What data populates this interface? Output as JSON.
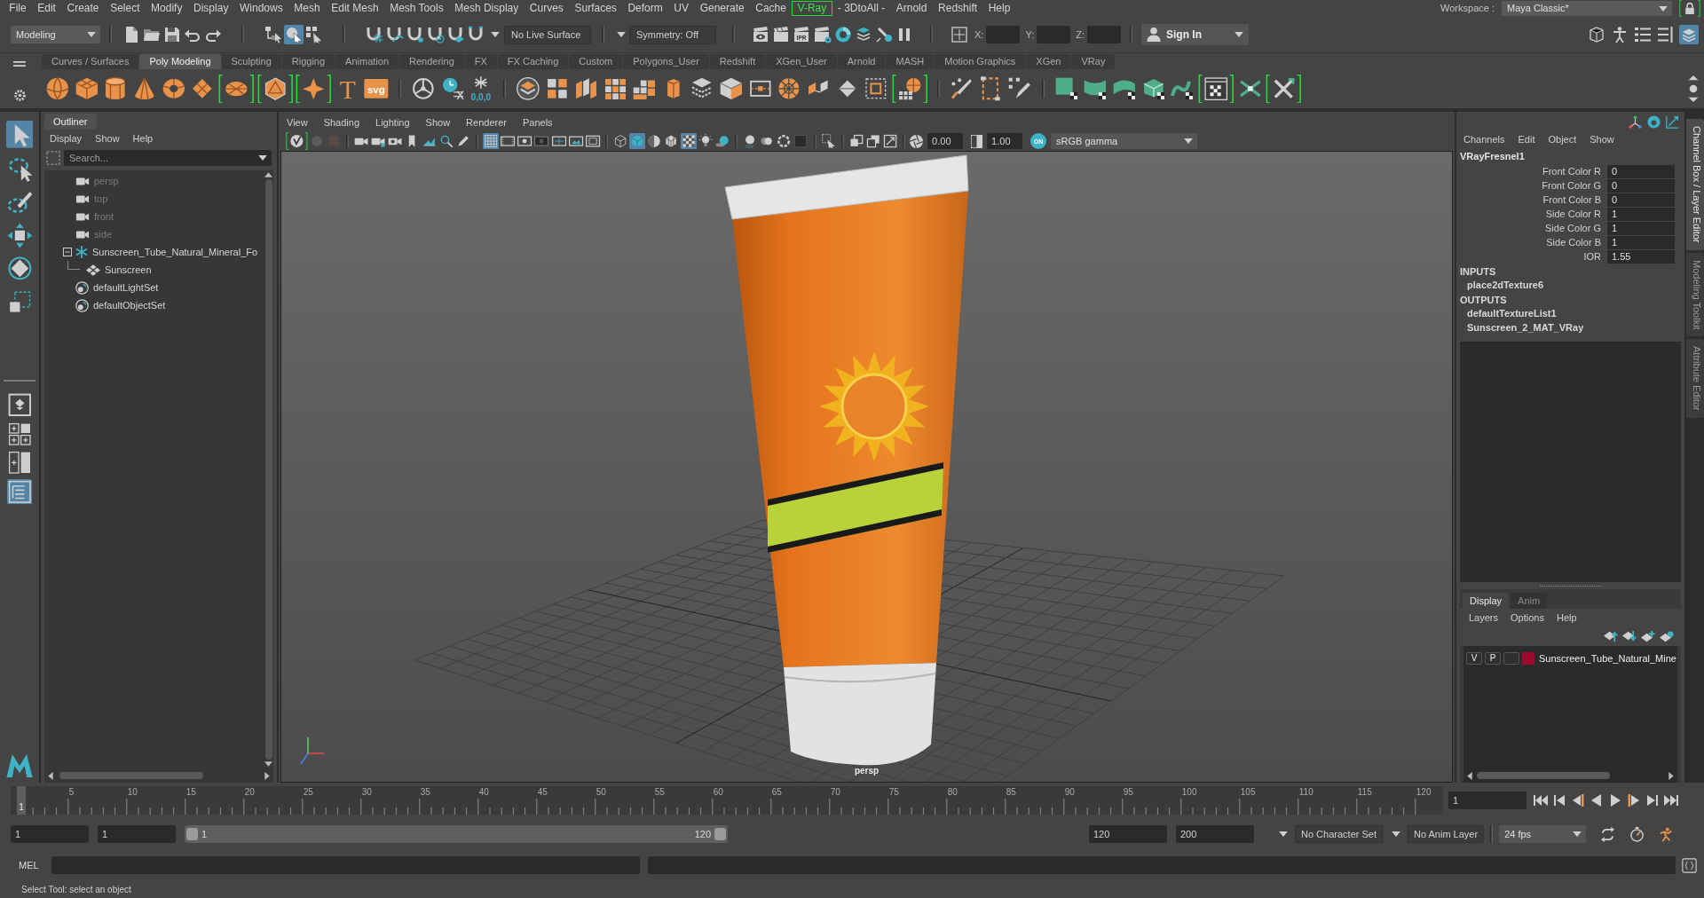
{
  "menu_bar": {
    "items": [
      {
        "label": "File",
        "highlighted": false
      },
      {
        "label": "Edit",
        "highlighted": false
      },
      {
        "label": "Create",
        "highlighted": false
      },
      {
        "label": "Select",
        "highlighted": false
      },
      {
        "label": "Modify",
        "highlighted": false
      },
      {
        "label": "Display",
        "highlighted": false
      },
      {
        "label": "Windows",
        "highlighted": false
      },
      {
        "label": "Mesh",
        "highlighted": false
      },
      {
        "label": "Edit Mesh",
        "highlighted": false
      },
      {
        "label": "Mesh Tools",
        "highlighted": false
      },
      {
        "label": "Mesh Display",
        "highlighted": false
      },
      {
        "label": "Curves",
        "highlighted": false
      },
      {
        "label": "Surfaces",
        "highlighted": false
      },
      {
        "label": "Deform",
        "highlighted": false
      },
      {
        "label": "UV",
        "highlighted": false
      },
      {
        "label": "Generate",
        "highlighted": false
      },
      {
        "label": "Cache",
        "highlighted": false
      },
      {
        "label": "V-Ray",
        "highlighted": true
      },
      {
        "label": "- 3DtoAll -",
        "highlighted": false
      },
      {
        "label": "Arnold",
        "highlighted": false
      },
      {
        "label": "Redshift",
        "highlighted": false
      },
      {
        "label": "Help",
        "highlighted": false
      }
    ],
    "workspace_label": "Workspace :",
    "workspace": "Maya Classic*",
    "lock": {
      "highlighted": true
    }
  },
  "status_line": {
    "mode": "Modeling",
    "tools": [
      {
        "on": false
      },
      {
        "on": false
      },
      {
        "on": false
      },
      {
        "on": false
      },
      {
        "on": false
      },
      {
        "on": false
      },
      {
        "on": true
      },
      {
        "on": false
      },
      {
        "on": false
      },
      {
        "on": false
      },
      {
        "on": false
      },
      {
        "on": false
      },
      {
        "on": false
      },
      {
        "on": false
      },
      {
        "on": false
      },
      {
        "on": false
      },
      {
        "on": false,
        "label": "IPR"
      },
      {
        "on": false
      },
      {
        "on": false
      },
      {
        "on": false
      },
      {
        "on": false
      },
      {
        "on": false
      },
      {
        "on": false
      }
    ],
    "live_surface": "No Live Surface",
    "symmetry": "Symmetry: Off",
    "coords": [
      {
        "label": "X:"
      },
      {
        "label": "Y:"
      },
      {
        "label": "Z:"
      }
    ],
    "sign_in": "Sign In",
    "panel_buttons": [
      {
        "on": false
      },
      {
        "on": false
      },
      {
        "on": false
      },
      {
        "on": false
      },
      {
        "on": true
      }
    ]
  },
  "shelf": {
    "tabs": [
      {
        "label": "Curves / Surfaces",
        "selected": false
      },
      {
        "label": "Poly Modeling",
        "selected": true
      },
      {
        "label": "Sculpting",
        "selected": false
      },
      {
        "label": "Rigging",
        "selected": false
      },
      {
        "label": "Animation",
        "selected": false
      },
      {
        "label": "Rendering",
        "selected": false
      },
      {
        "label": "FX",
        "selected": false
      },
      {
        "label": "FX Caching",
        "selected": false
      },
      {
        "label": "Custom",
        "selected": false
      },
      {
        "label": "Polygons_User",
        "selected": false
      },
      {
        "label": "Redshift",
        "selected": false
      },
      {
        "label": "XGen_User",
        "selected": false
      },
      {
        "label": "Arnold",
        "selected": false
      },
      {
        "label": "MASH",
        "selected": false
      },
      {
        "label": "Motion Graphics",
        "selected": false
      },
      {
        "label": "XGen",
        "selected": false
      },
      {
        "label": "VRay",
        "selected": false
      }
    ],
    "tools": [
      {
        "highlighted": false
      },
      {
        "highlighted": false
      },
      {
        "highlighted": false
      },
      {
        "highlighted": false
      },
      {
        "highlighted": false
      },
      {
        "highlighted": false
      },
      {
        "highlighted": true
      },
      {
        "highlighted": true
      },
      {
        "highlighted": true
      },
      {
        "highlighted": false,
        "label": "T"
      },
      {
        "highlighted": false,
        "label": "svg"
      },
      {
        "highlighted": false
      },
      {
        "highlighted": false
      },
      {
        "highlighted": false,
        "label": "0,0,0"
      },
      {
        "highlighted": false
      },
      {
        "highlighted": false
      },
      {
        "highlighted": false
      },
      {
        "highlighted": false
      },
      {
        "highlighted": false
      },
      {
        "highlighted": false
      },
      {
        "highlighted": false
      },
      {
        "highlighted": false
      },
      {
        "highlighted": false
      },
      {
        "highlighted": false
      },
      {
        "highlighted": false
      },
      {
        "highlighted": false
      },
      {
        "highlighted": false
      },
      {
        "highlighted": true
      },
      {
        "highlighted": false
      },
      {
        "highlighted": false
      },
      {
        "highlighted": false
      },
      {
        "highlighted": false
      },
      {
        "highlighted": false
      },
      {
        "highlighted": false
      },
      {
        "highlighted": false
      },
      {
        "highlighted": false
      },
      {
        "highlighted": true
      },
      {
        "highlighted": false
      },
      {
        "highlighted": true
      }
    ]
  },
  "toolbox": {
    "tools": [
      {
        "selected": true
      },
      {
        "selected": false
      },
      {
        "selected": false
      },
      {
        "selected": false
      },
      {
        "selected": false
      },
      {
        "selected": false
      }
    ],
    "layouts": [
      {
        "selected": false
      },
      {
        "selected": false
      },
      {
        "selected": false
      },
      {
        "selected": true
      }
    ]
  },
  "outliner": {
    "title": "Outliner",
    "menus": [
      "Display",
      "Show",
      "Help"
    ],
    "search": {
      "placeholder": "Search..."
    },
    "items": [
      {
        "label": "persp",
        "kind": "camera",
        "hidden": true
      },
      {
        "label": "top",
        "kind": "camera",
        "hidden": true
      },
      {
        "label": "front",
        "kind": "camera",
        "hidden": true
      },
      {
        "label": "side",
        "kind": "camera",
        "hidden": true
      },
      {
        "label": "Sunscreen_Tube_Natural_Mineral_Fo",
        "kind": "group",
        "hidden": false,
        "expanded": true,
        "children": [
          {
            "label": "Sunscreen",
            "kind": "mesh",
            "hidden": false
          }
        ]
      },
      {
        "label": "defaultLightSet",
        "kind": "set",
        "hidden": false
      },
      {
        "label": "defaultObjectSet",
        "kind": "set",
        "hidden": false
      }
    ]
  },
  "viewport": {
    "menus": [
      "View",
      "Shading",
      "Lighting",
      "Show",
      "Renderer",
      "Panels"
    ],
    "toolbar": [
      {
        "on": false,
        "highlighted": true
      },
      {
        "on": false,
        "highlighted": false
      },
      {
        "on": false,
        "highlighted": false
      },
      {
        "on": false,
        "highlighted": false
      },
      {
        "on": false,
        "highlighted": false
      },
      {
        "on": false,
        "highlighted": false
      },
      {
        "on": false,
        "highlighted": false
      },
      {
        "on": false,
        "highlighted": false
      },
      {
        "on": false,
        "highlighted": false
      },
      {
        "on": false,
        "highlighted": false
      },
      {
        "on": true,
        "highlighted": false
      },
      {
        "on": false,
        "highlighted": false
      },
      {
        "on": false,
        "highlighted": false
      },
      {
        "on": false,
        "highlighted": false
      },
      {
        "on": false,
        "highlighted": false
      },
      {
        "on": false,
        "highlighted": false
      },
      {
        "on": false,
        "highlighted": false
      },
      {
        "on": false,
        "highlighted": false
      },
      {
        "on": true,
        "highlighted": false
      },
      {
        "on": false,
        "highlighted": false
      },
      {
        "on": false,
        "highlighted": false
      },
      {
        "on": true,
        "highlighted": false
      },
      {
        "on": false,
        "highlighted": false
      },
      {
        "on": false,
        "highlighted": false
      },
      {
        "on": false,
        "highlighted": false
      },
      {
        "on": false,
        "highlighted": false
      },
      {
        "on": false,
        "highlighted": false
      },
      {
        "on": false,
        "highlighted": false
      },
      {
        "on": false,
        "highlighted": false
      },
      {
        "on": false,
        "highlighted": false
      },
      {
        "on": false,
        "highlighted": false
      },
      {
        "on": false,
        "highlighted": false
      }
    ],
    "exposure": "0.00",
    "gamma": "1.00",
    "color_management": {
      "label": "ON",
      "on": true
    },
    "color_space": "sRGB gamma",
    "camera": "persp"
  },
  "channel_box": {
    "menus": [
      "Channels",
      "Edit",
      "Object",
      "Show"
    ],
    "node": "VRayFresnel1",
    "attributes": [
      {
        "name": "Front Color R",
        "value": "0"
      },
      {
        "name": "Front Color G",
        "value": "0"
      },
      {
        "name": "Front Color B",
        "value": "0"
      },
      {
        "name": "Side Color R",
        "value": "1"
      },
      {
        "name": "Side Color G",
        "value": "1"
      },
      {
        "name": "Side Color B",
        "value": "1"
      },
      {
        "name": "IOR",
        "value": "1.55"
      }
    ],
    "inputs_title": "INPUTS",
    "inputs": [
      "place2dTexture6"
    ],
    "outputs_title": "OUTPUTS",
    "outputs": [
      "defaultTextureList1",
      "Sunscreen_2_MAT_VRay"
    ]
  },
  "layer_editor": {
    "tabs": [
      {
        "label": "Display",
        "selected": true
      },
      {
        "label": "Anim",
        "selected": false
      }
    ],
    "menus": [
      "Layers",
      "Options",
      "Help"
    ],
    "layers": [
      {
        "visibility": "V",
        "playback": "P",
        "color": "#9c0b2c",
        "name": "Sunscreen_Tube_Natural_Mine"
      }
    ]
  },
  "side_tabs": [
    {
      "label": "Channel Box / Layer Editor",
      "selected": true
    },
    {
      "label": "Modeling Toolkit",
      "selected": false
    },
    {
      "label": "Attribute Editor",
      "selected": false
    }
  ],
  "timeline": {
    "ticks": [
      "5",
      "10",
      "15",
      "20",
      "25",
      "30",
      "35",
      "40",
      "45",
      "50",
      "55",
      "60",
      "65",
      "70",
      "75",
      "80",
      "85",
      "90",
      "95",
      "100",
      "105",
      "110",
      "115",
      "120"
    ],
    "current_frame": "1",
    "frame_field": "1"
  },
  "range": {
    "animation_start": "1",
    "playback_start": "1",
    "slider_start": "1",
    "slider_end": "120",
    "playback_end": "120",
    "animation_end": "200",
    "character_set": "No Character Set",
    "anim_layer": "No Anim Layer",
    "fps": "24 fps"
  },
  "command_line": {
    "language": "MEL"
  },
  "help_line": "Select Tool: select an object"
}
